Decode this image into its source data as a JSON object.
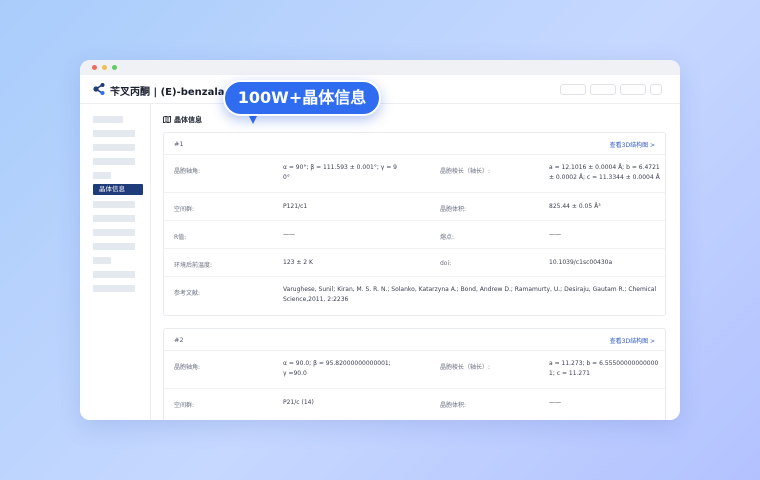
{
  "header": {
    "app_title": "苄叉丙酮 | (E)-benzalaceton"
  },
  "callout": {
    "text": "100W+晶体信息"
  },
  "sidebar": {
    "active_label": "晶体信息"
  },
  "section": {
    "title": "晶体信息"
  },
  "cards": [
    {
      "number": "#1",
      "link": "查看3D结构图 >",
      "rows": [
        {
          "l1": "晶胞轴角:",
          "v1a": "α = 90°; β = 111.593 ± 0.001°; γ = 9",
          "v1b": "0°",
          "l2": "晶胞棱长（轴长）:",
          "v2a": "a = 12.1016 ± 0.0004 Å; b = 6.4721",
          "v2b": "± 0.0002 Å; c = 11.3344 ± 0.0004 Å"
        },
        {
          "l1": "空间群:",
          "v1a": "P121/c1",
          "v1b": "",
          "l2": "晶胞体积:",
          "v2a": "825.44 ± 0.05 Å³",
          "v2b": ""
        },
        {
          "l1": "R值:",
          "v1a": "——",
          "v1b": "",
          "l2": "熔点:",
          "v2a": "——",
          "v2b": ""
        },
        {
          "l1": "环境后前温度:",
          "v1a": "123 ± 2 K",
          "v1b": "",
          "l2": "doi:",
          "v2a": "10.1039/c1sc00430a",
          "v2b": ""
        },
        {
          "l1": "参考文献:",
          "v1a": "Varughese, Sunil; Kiran, M. S. R. N.; Solanko, Katarzyna A.; Bond, Andrew D.; Ramamurty, U.; Desiraju, Gautam R.; Chemical",
          "v1b": "Science,2011, 2:2236",
          "l2": "",
          "v2a": "",
          "v2b": ""
        }
      ]
    },
    {
      "number": "#2",
      "link": "查看3D结构图 >",
      "rows": [
        {
          "l1": "晶胞轴角:",
          "v1a": "α = 90.0; β = 95.82000000000001;",
          "v1b": "γ =90.0",
          "l2": "晶胞棱长（轴长）:",
          "v2a": "a = 11.273; b = 6.55500000000000",
          "v2b": "1; c = 11.271"
        },
        {
          "l1": "空间群:",
          "v1a": "P21/c (14)",
          "v1b": "",
          "l2": "晶胞体积:",
          "v2a": "——",
          "v2b": ""
        }
      ]
    }
  ]
}
